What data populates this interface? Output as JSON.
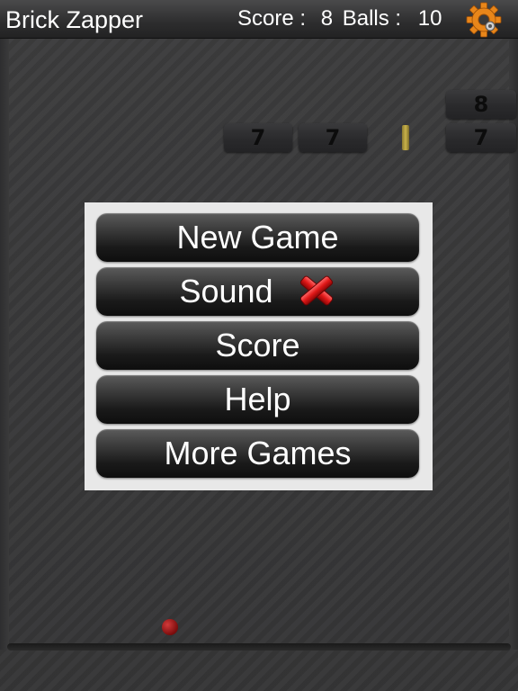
{
  "header": {
    "title": "Brick Zapper",
    "score_label": "Score :",
    "score_value": "8",
    "balls_label": "Balls :",
    "balls_value": "10",
    "settings_icon": "gear-icon"
  },
  "bricks": [
    {
      "value": "8"
    },
    {
      "value": "7"
    },
    {
      "value": "7"
    },
    {
      "value": "7"
    }
  ],
  "menu": {
    "new_game": "New Game",
    "sound": "Sound",
    "sound_state_icon": "red-x-icon",
    "score": "Score",
    "help": "Help",
    "more_games": "More Games"
  },
  "colors": {
    "ball": "#a01818",
    "menu_panel": "#e8e8e8",
    "button": "#1a1a1a",
    "gear": "#e8861a"
  }
}
